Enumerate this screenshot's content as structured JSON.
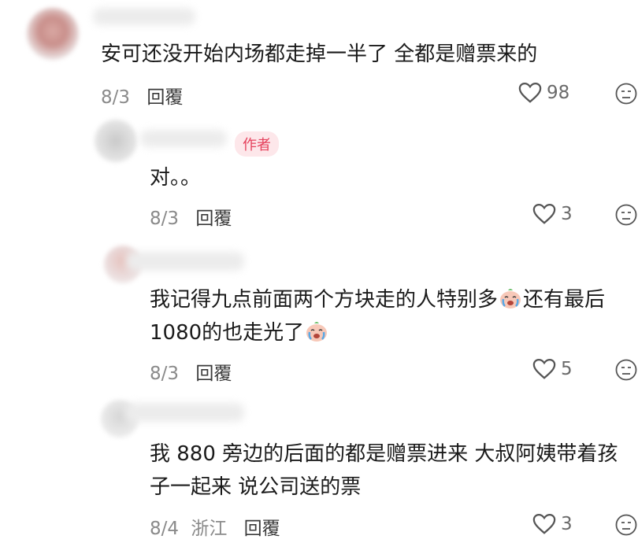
{
  "comments": [
    {
      "text": "安可还没开始内场都走掉一半了 全都是赠票来的",
      "date": "8/3",
      "reply_label": "回覆",
      "likes": "98"
    },
    {
      "badge": "作者",
      "text": "对。。",
      "date": "8/3",
      "reply_label": "回覆",
      "likes": "3"
    },
    {
      "text_line1_a": "我记得九点前面两个方块走的人特别多",
      "text_line1_b": "还有最后",
      "text_line2": "1080的也走光了",
      "emoji_name": "crying-face-icon",
      "date": "8/3",
      "reply_label": "回覆",
      "likes": "5"
    },
    {
      "text_line1": "我 880 旁边的后面的都是赠票进来 大叔阿姨带着孩",
      "text_line2": "子一起来 说公司送的票",
      "date": "8/4",
      "location": "浙江",
      "reply_label": "回覆",
      "likes": "3"
    }
  ],
  "colors": {
    "badge_bg": "#fde7ea",
    "badge_text": "#e5425d",
    "meta_gray": "#8a8a8a"
  }
}
